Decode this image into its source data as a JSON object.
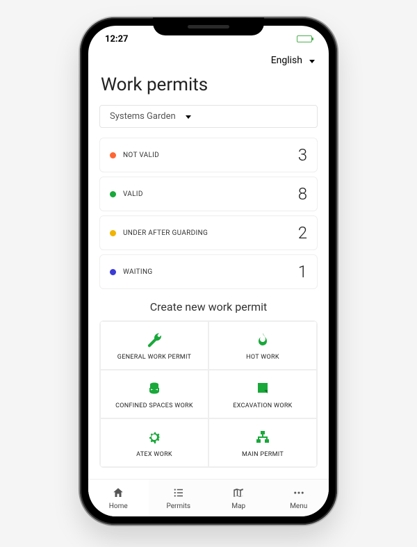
{
  "status_bar": {
    "time": "12:27"
  },
  "header": {
    "language": "English",
    "title": "Work permits",
    "location": "Systems Garden"
  },
  "statuses": [
    {
      "label": "NOT VALID",
      "count": "3",
      "color": "#ff6633"
    },
    {
      "label": "VALID",
      "count": "8",
      "color": "#19a83a"
    },
    {
      "label": "UNDER AFTER GUARDING",
      "count": "2",
      "color": "#f0b400"
    },
    {
      "label": "WAITING",
      "count": "1",
      "color": "#3b3bd6"
    }
  ],
  "create": {
    "title": "Create new work permit",
    "types": [
      {
        "label": "GENERAL WORK PERMIT",
        "icon": "wrench-icon"
      },
      {
        "label": "HOT WORK",
        "icon": "fire-icon"
      },
      {
        "label": "CONFINED SPACES WORK",
        "icon": "stack-icon"
      },
      {
        "label": "EXCAVATION WORK",
        "icon": "dig-icon"
      },
      {
        "label": "ATEX WORK",
        "icon": "gear-icon"
      },
      {
        "label": "MAIN PERMIT",
        "icon": "org-icon"
      }
    ]
  },
  "nav": {
    "items": [
      {
        "label": "Home",
        "icon": "home-icon"
      },
      {
        "label": "Permits",
        "icon": "list-icon"
      },
      {
        "label": "Map",
        "icon": "map-icon"
      },
      {
        "label": "Menu",
        "icon": "dots-icon"
      }
    ]
  }
}
